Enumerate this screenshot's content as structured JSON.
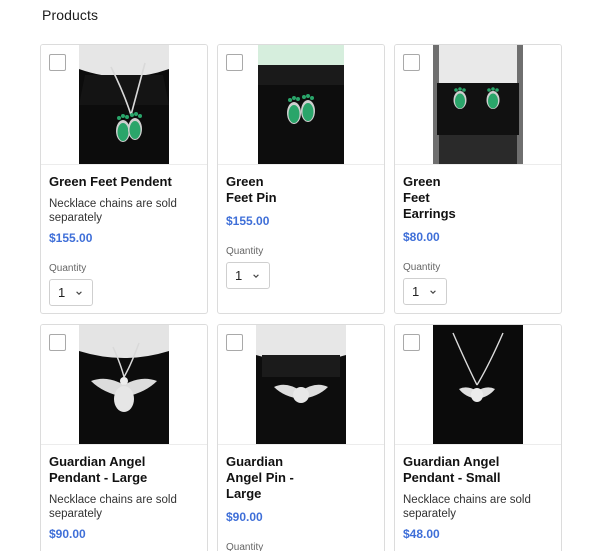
{
  "page": {
    "section_title": "Products"
  },
  "products": [
    {
      "name": "Green Feet Pendent",
      "desc": "Necklace chains are sold separately",
      "price": "$155.00",
      "qty_label": "Quantity",
      "qty": "1"
    },
    {
      "name": "Green\nFeet Pin",
      "desc": "",
      "price": "$155.00",
      "qty_label": "Quantity",
      "qty": "1"
    },
    {
      "name": "Green\nFeet\nEarrings",
      "desc": "",
      "price": "$80.00",
      "qty_label": "Quantity",
      "qty": "1"
    },
    {
      "name": "Guardian Angel\nPendant - Large",
      "desc": "Necklace chains are sold separately",
      "price": "$90.00"
    },
    {
      "name": "Guardian\nAngel Pin -\nLarge",
      "desc": "",
      "price": "$90.00",
      "qty_label": "Quantity"
    },
    {
      "name": "Guardian Angel\nPendant - Small",
      "desc": "Necklace chains are sold separately",
      "price": "$48.00"
    }
  ],
  "icons": {
    "checkbox": "checkbox-icon",
    "chevron": "chevron-down-icon"
  },
  "colors": {
    "price": "#3f6fd8",
    "border": "#dcdcdc"
  }
}
